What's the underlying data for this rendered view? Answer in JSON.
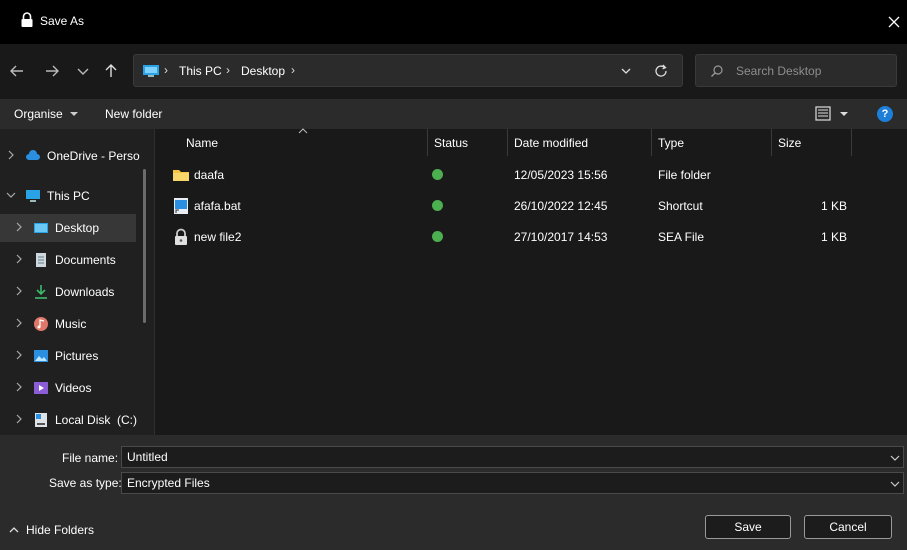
{
  "window": {
    "title": "Save As"
  },
  "address": {
    "crumbs": [
      "This PC",
      "Desktop"
    ]
  },
  "search": {
    "placeholder": "Search Desktop"
  },
  "toolbar": {
    "organise_label": "Organise",
    "new_folder_label": "New folder",
    "help_label": "?"
  },
  "sidebar": {
    "items": [
      {
        "label": "OneDrive - Perso",
        "icon": "cloud-icon"
      },
      {
        "label": "This PC",
        "icon": "computer-icon"
      },
      {
        "label": "Desktop",
        "icon": "desktop-icon"
      },
      {
        "label": "Documents",
        "icon": "documents-icon"
      },
      {
        "label": "Downloads",
        "icon": "download-icon"
      },
      {
        "label": "Music",
        "icon": "music-icon"
      },
      {
        "label": "Pictures",
        "icon": "pictures-icon"
      },
      {
        "label": "Videos",
        "icon": "videos-icon"
      },
      {
        "label": "Local Disk  (C:)",
        "icon": "disk-icon"
      }
    ]
  },
  "columns": {
    "name": "Name",
    "status": "Status",
    "date": "Date modified",
    "type": "Type",
    "size": "Size"
  },
  "files": [
    {
      "name": "daafa",
      "date": "12/05/2023 15:56",
      "type": "File folder",
      "size": "",
      "icon": "folder-icon"
    },
    {
      "name": "afafa.bat",
      "date": "26/10/2022 12:45",
      "type": "Shortcut",
      "size": "1 KB",
      "icon": "shortcut-icon"
    },
    {
      "name": "new file2",
      "date": "27/10/2017 14:53",
      "type": "SEA File",
      "size": "1 KB",
      "icon": "lock-file-icon"
    }
  ],
  "form": {
    "filename_label": "File name:",
    "filename_value": "Untitled",
    "type_label": "Save as type:",
    "type_value": "Encrypted Files"
  },
  "footer": {
    "hide_folders_label": "Hide Folders",
    "save_label": "Save",
    "cancel_label": "Cancel"
  },
  "colors": {
    "accent": "#1e7fd8",
    "status_ok": "#4caf50",
    "folder": "#f4c542"
  }
}
